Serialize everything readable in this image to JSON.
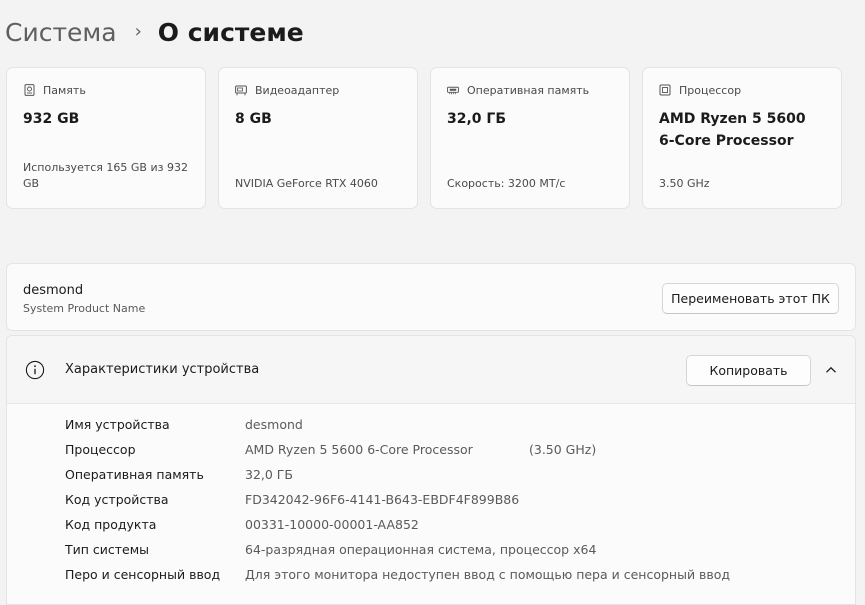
{
  "breadcrumb": {
    "parent": "Система",
    "separator": "›",
    "current": "О системе"
  },
  "cards": [
    {
      "icon": "storage-icon",
      "label": "Память",
      "value": "932 GB",
      "sub": "Используется 165 GB из 932 GB"
    },
    {
      "icon": "gpu-icon",
      "label": "Видеоадаптер",
      "value": "8 GB",
      "sub": "NVIDIA GeForce RTX 4060"
    },
    {
      "icon": "ram-icon",
      "label": "Оперативная память",
      "value": "32,0 ГБ",
      "sub": "Скорость: 3200 МТ/с"
    },
    {
      "icon": "cpu-icon",
      "label": "Процессор",
      "value": "AMD Ryzen 5 5600 6-Core Processor",
      "sub": "3.50 GHz"
    }
  ],
  "device": {
    "name": "desmond",
    "model": "System Product Name",
    "rename_label": "Переименовать этот ПК"
  },
  "specs": {
    "title": "Характеристики устройства",
    "copy_label": "Копировать",
    "rows": [
      {
        "label": "Имя устройства",
        "value": "desmond",
        "extra": ""
      },
      {
        "label": "Процессор",
        "value": "AMD Ryzen 5 5600 6-Core Processor",
        "extra": "(3.50 GHz)"
      },
      {
        "label": "Оперативная память",
        "value": "32,0 ГБ",
        "extra": ""
      },
      {
        "label": "Код устройства",
        "value": "FD342042-96F6-4141-B643-EBDF4F899B86",
        "extra": ""
      },
      {
        "label": "Код продукта",
        "value": "00331-10000-00001-AA852",
        "extra": ""
      },
      {
        "label": "Тип системы",
        "value": "64-разрядная операционная система, процессор x64",
        "extra": ""
      },
      {
        "label": "Перо и сенсорный ввод",
        "value": "Для этого монитора недоступен ввод с помощью пера и сенсорный ввод",
        "extra": ""
      }
    ]
  },
  "colors": {
    "background": "#f3f3f3",
    "card": "#fbfbfb",
    "border": "#e4e4e4"
  }
}
